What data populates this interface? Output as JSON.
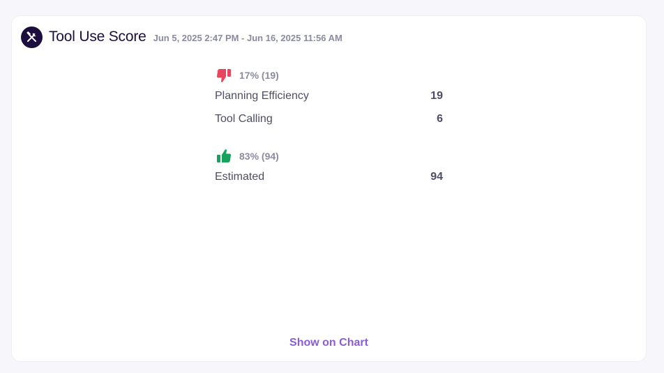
{
  "header": {
    "title": "Tool Use Score",
    "date_range": "Jun 5, 2025 2:47 PM - Jun 16, 2025 11:56 AM",
    "icon": "tools-icon"
  },
  "negative": {
    "icon": "thumbs-down-icon",
    "color": "#e8465e",
    "summary": "17% (19)",
    "rows": [
      {
        "label": "Planning Efficiency",
        "value": "19"
      },
      {
        "label": "Tool Calling",
        "value": "6"
      }
    ]
  },
  "positive": {
    "icon": "thumbs-up-icon",
    "color": "#16a45c",
    "summary": "83% (94)",
    "rows": [
      {
        "label": "Estimated",
        "value": "94"
      }
    ]
  },
  "footer": {
    "link_label": "Show on Chart"
  }
}
